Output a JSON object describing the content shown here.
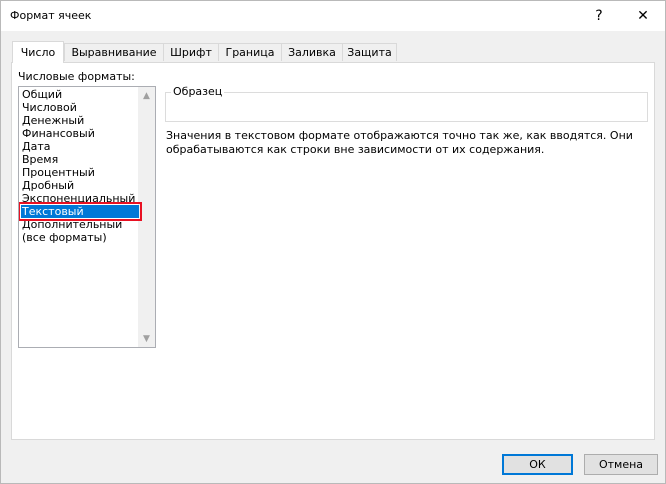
{
  "window": {
    "title": "Формат ячеек",
    "help_icon": "?",
    "close_icon": "✕"
  },
  "tabs": [
    {
      "label": "Число",
      "active": true
    },
    {
      "label": "Выравнивание",
      "active": false
    },
    {
      "label": "Шрифт",
      "active": false
    },
    {
      "label": "Граница",
      "active": false
    },
    {
      "label": "Заливка",
      "active": false
    },
    {
      "label": "Защита",
      "active": false
    }
  ],
  "categories": {
    "label": "Числовые форматы:",
    "items": [
      "Общий",
      "Числовой",
      "Денежный",
      "Финансовый",
      "Дата",
      "Время",
      "Процентный",
      "Дробный",
      "Экспоненциальный",
      "Текстовый",
      "Дополнительный",
      "(все форматы)"
    ],
    "selected": "Текстовый",
    "scroll_up_icon": "▲",
    "scroll_down_icon": "▼"
  },
  "sample": {
    "legend": "Образец",
    "value": ""
  },
  "description": "Значения в текстовом формате отображаются точно так же, как вводятся. Они обрабатываются как строки вне зависимости от их содержания.",
  "buttons": {
    "ok": "ОК",
    "cancel": "Отмена"
  },
  "colors": {
    "selection": "#0078d7",
    "highlight_outline": "#e81123"
  }
}
